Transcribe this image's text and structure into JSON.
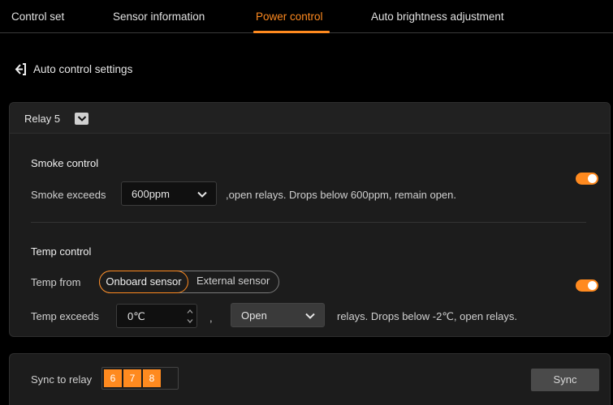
{
  "tabs": [
    {
      "label": "Control set"
    },
    {
      "label": "Sensor information"
    },
    {
      "label": "Power control",
      "active": true
    },
    {
      "label": "Auto brightness adjustment"
    }
  ],
  "back": {
    "label": "Auto control settings",
    "icon": "back-arrow-icon"
  },
  "relay": {
    "label": "Relay 5"
  },
  "smoke": {
    "title": "Smoke control",
    "exceeds_label": "Smoke exceeds",
    "threshold": "600ppm",
    "tail": ",open relays. Drops below 600ppm, remain open.",
    "enabled": true
  },
  "temp": {
    "title": "Temp control",
    "from_label": "Temp from",
    "sources": [
      "Onboard sensor",
      "External sensor"
    ],
    "selected_source": "Onboard sensor",
    "exceeds_label": "Temp exceeds",
    "threshold": "0℃",
    "comma": ",",
    "action": "Open",
    "tail": "relays. Drops below -2℃, open relays.",
    "enabled": true
  },
  "sync": {
    "label": "Sync to relay",
    "relays": [
      "6",
      "7",
      "8"
    ],
    "button": "Sync"
  },
  "colors": {
    "accent": "#ff8a1f",
    "background": "#000000",
    "panel": "#1c1c1c"
  }
}
